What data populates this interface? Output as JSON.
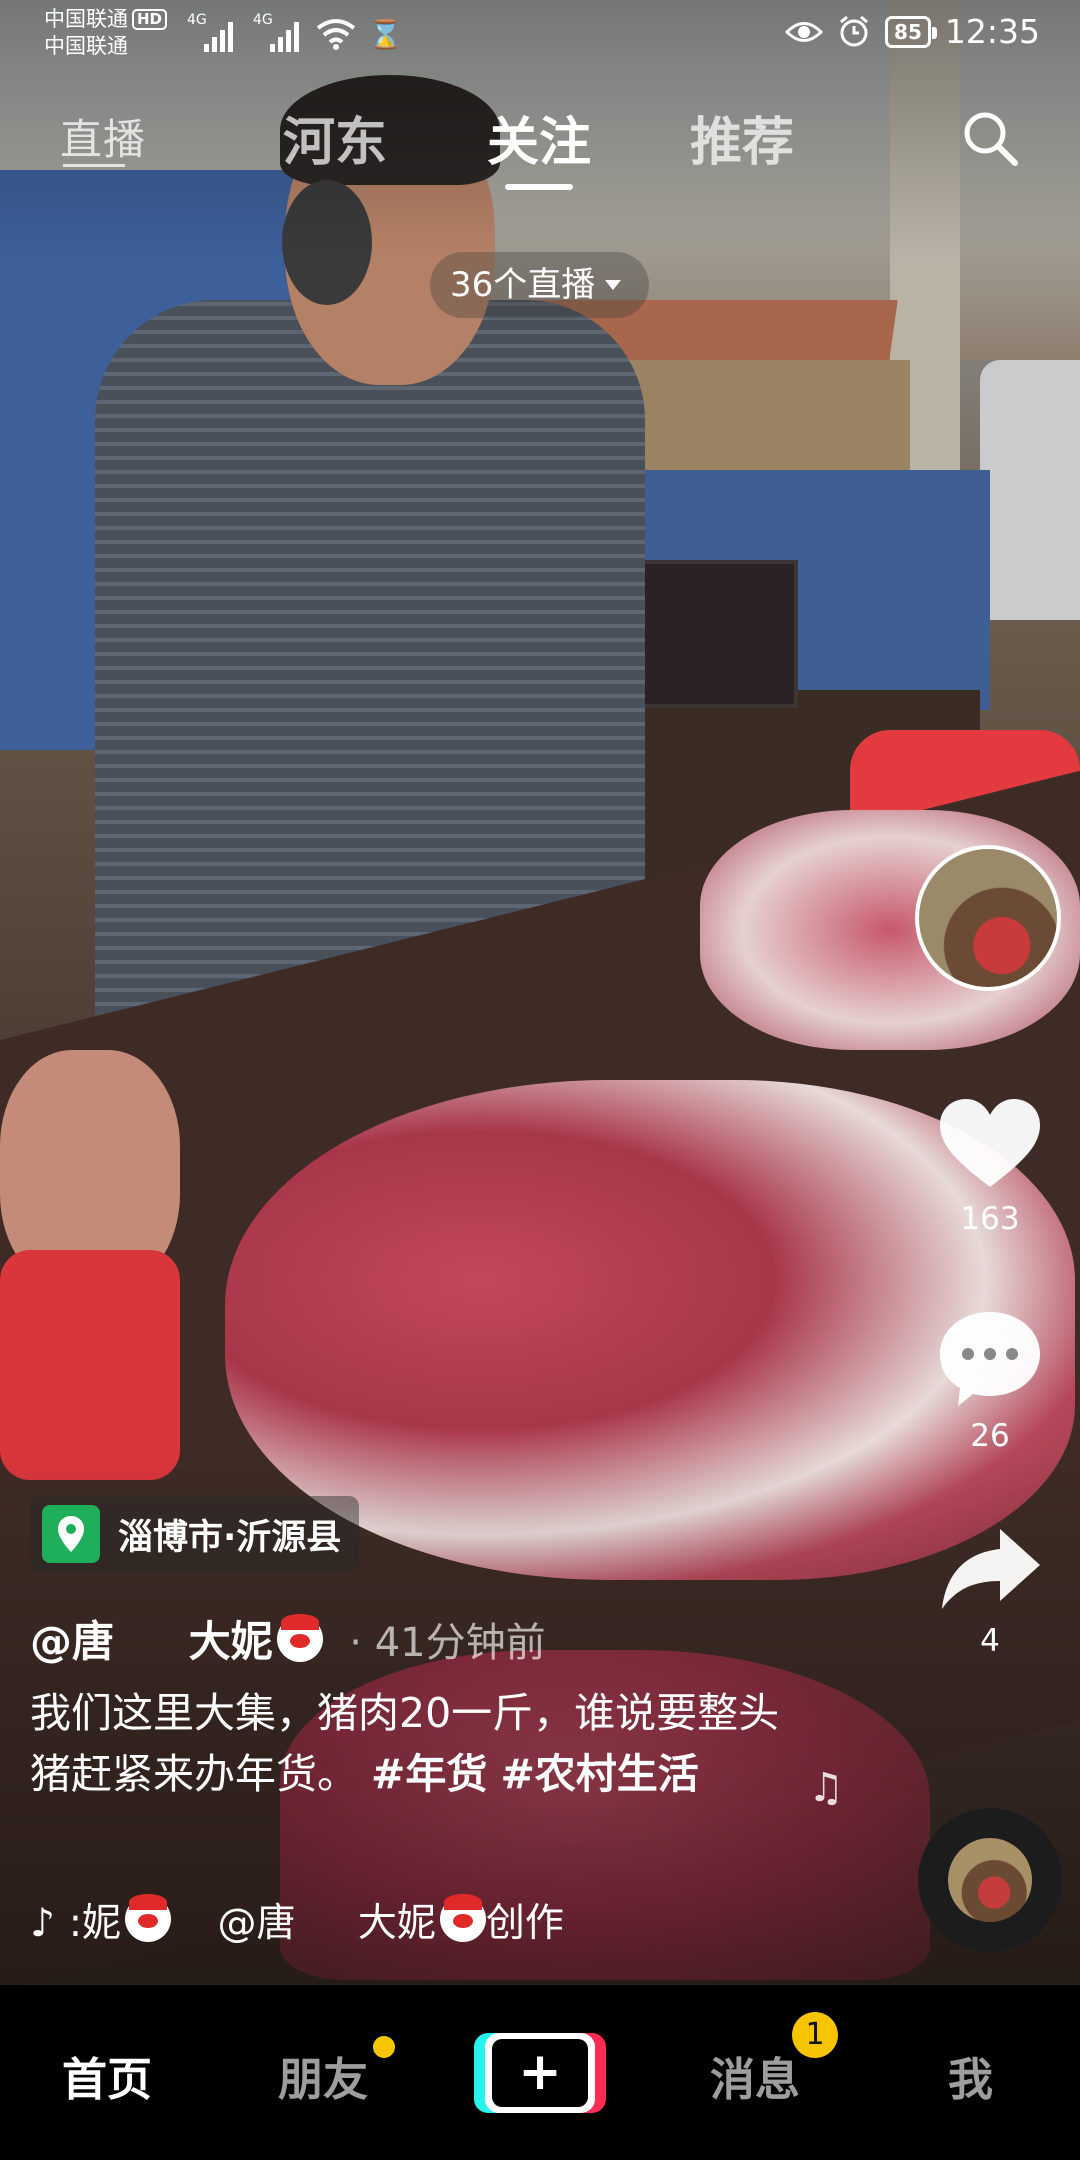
{
  "status_bar": {
    "carrier_1": "中国联通",
    "hd_badge": "HD",
    "carrier_2": "中国联通",
    "signal_1_label": "4G",
    "signal_2_label": "4G",
    "battery": "85",
    "time": "12:35"
  },
  "top_nav": {
    "live_label": "直播",
    "tabs": [
      {
        "label": "河东"
      },
      {
        "label": "关注"
      },
      {
        "label": "推荐"
      }
    ],
    "active_tab": "关注",
    "live_count_pill": "36个直播"
  },
  "right_rail": {
    "like_count": "163",
    "comment_count": "26",
    "share_count": "4"
  },
  "post": {
    "location": "淄博市·沂源县",
    "author": "@唐",
    "author_suffix": "大妮",
    "time_ago": "· 41分钟前",
    "caption_text": "我们这里大集，猪肉20一斤，谁说要整头猪赶紧来办年货。",
    "hashtag_1": "#年货",
    "hashtag_2": "#农村生活",
    "music_a": ":妮",
    "music_b": "@唐",
    "music_c": "大妮",
    "music_d": "创作"
  },
  "tab_bar": {
    "home": "首页",
    "friends": "朋友",
    "create": "+",
    "messages": "消息",
    "messages_badge": "1",
    "me": "我"
  },
  "colors": {
    "location_icon_bg": "#1fae59",
    "badge": "#f6c400",
    "tiktok_cyan": "#25f4ee",
    "tiktok_red": "#fe2c55"
  }
}
